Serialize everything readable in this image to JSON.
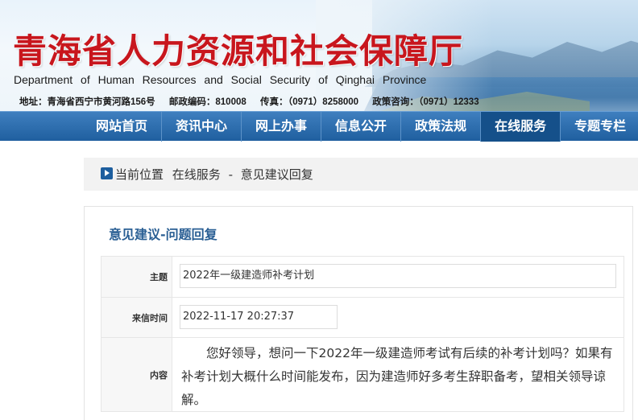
{
  "header": {
    "title_cn": "青海省人力资源和社会保障厅",
    "title_en": "Department of Human Resources and Social Security of Qinghai Province",
    "address": "地址：青海省西宁市黄河路156号",
    "postcode": "邮政编码：810008",
    "fax": "传真：（0971）8258000",
    "consult": "政策咨询：（0971）12333"
  },
  "nav": {
    "items": [
      "网站首页",
      "资讯中心",
      "网上办事",
      "信息公开",
      "政策法规",
      "在线服务",
      "专题专栏"
    ],
    "active": "在线服务"
  },
  "breadcrumb": {
    "label": "当前位置",
    "section": "在线服务",
    "separator": "-",
    "page": "意见建议回复"
  },
  "panel": {
    "title": "意见建议-问题回复",
    "fields": {
      "subject_label": "主题",
      "subject_value": "2022年一级建造师补考计划",
      "date_label": "来信时间",
      "date_value": "2022-11-17 20:27:37",
      "content_label": "内容",
      "content_value": "您好领导，想问一下2022年一级建造师考试有后续的补考计划吗？如果有补考计划大概什么时间能发布，因为建造师好多考生辞职备考，望相关领导谅解。"
    }
  },
  "colors": {
    "brand_red": "#c8161d",
    "nav_blue": "#2f6fae",
    "nav_active": "#15508a",
    "panel_title": "#2a5f94"
  }
}
